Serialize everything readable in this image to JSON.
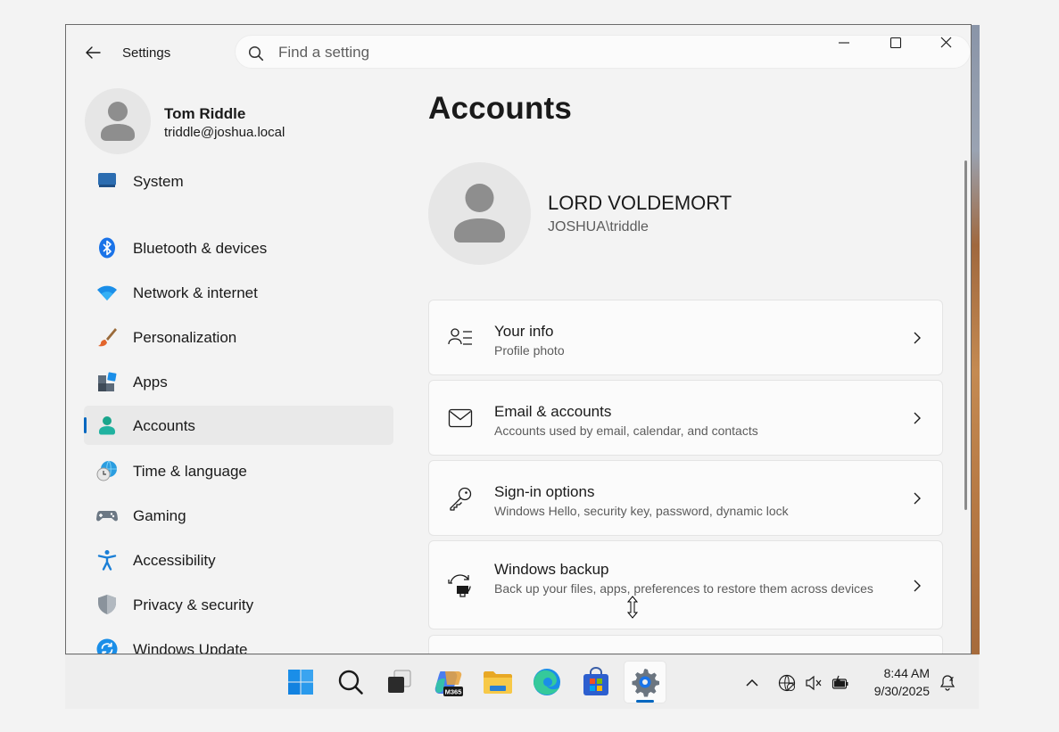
{
  "window": {
    "title": "Settings"
  },
  "search": {
    "placeholder": "Find a setting"
  },
  "profile": {
    "name": "Tom Riddle",
    "email": "triddle@joshua.local"
  },
  "sidebar": {
    "items": [
      {
        "label": "System",
        "icon": "system-icon"
      },
      {
        "label": "Bluetooth & devices",
        "icon": "bluetooth-icon"
      },
      {
        "label": "Network & internet",
        "icon": "wifi-icon"
      },
      {
        "label": "Personalization",
        "icon": "paintbrush-icon"
      },
      {
        "label": "Apps",
        "icon": "apps-icon"
      },
      {
        "label": "Accounts",
        "icon": "accounts-icon",
        "selected": true
      },
      {
        "label": "Time & language",
        "icon": "globe-clock-icon"
      },
      {
        "label": "Gaming",
        "icon": "gamepad-icon"
      },
      {
        "label": "Accessibility",
        "icon": "accessibility-icon"
      },
      {
        "label": "Privacy & security",
        "icon": "shield-icon"
      },
      {
        "label": "Windows Update",
        "icon": "update-icon"
      }
    ]
  },
  "main": {
    "title": "Accounts",
    "account": {
      "display_name": "LORD VOLDEMORT",
      "account_id": "JOSHUA\\triddle"
    },
    "cards": [
      {
        "title": "Your info",
        "subtitle": "Profile photo",
        "icon": "person-list-icon"
      },
      {
        "title": "Email & accounts",
        "subtitle": "Accounts used by email, calendar, and contacts",
        "icon": "mail-icon"
      },
      {
        "title": "Sign-in options",
        "subtitle": "Windows Hello, security key, password, dynamic lock",
        "icon": "key-icon"
      },
      {
        "title": "Windows backup",
        "subtitle": "Back up your files, apps, preferences to restore them across devices",
        "icon": "backup-icon"
      }
    ]
  },
  "taskbar": {
    "apps": [
      "start-icon",
      "search-icon",
      "task-view-icon",
      "m365-copilot-icon",
      "file-explorer-icon",
      "edge-icon",
      "store-icon",
      "settings-icon"
    ],
    "copilot_badge": "M365",
    "clock": {
      "time": "8:44 AM",
      "date": "9/30/2025"
    }
  },
  "colors": {
    "accent": "#0067c0",
    "selected_bg": "#e9e9e9",
    "card_bg": "#fbfbfb"
  }
}
